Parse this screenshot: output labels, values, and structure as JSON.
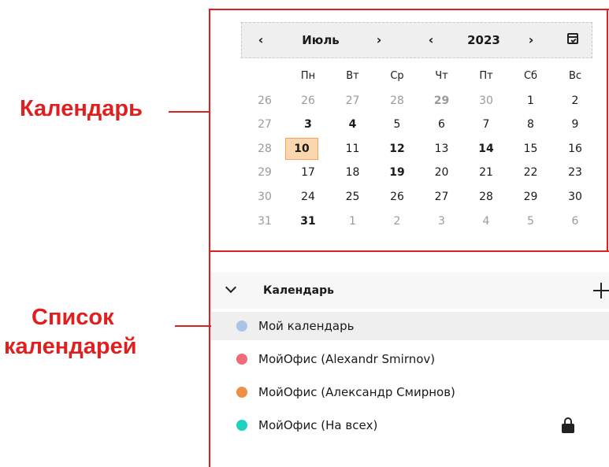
{
  "annotations": {
    "calendar_label": "Календарь",
    "list_label_line1": "Список",
    "list_label_line2": "календарей",
    "color": "#e02020"
  },
  "calendar": {
    "month": "Июль",
    "year": "2023",
    "prev_month_icon": "chevron-left-icon",
    "next_month_icon": "chevron-right-icon",
    "today_icon": "calendar-check-icon",
    "day_names": [
      "Пн",
      "Вт",
      "Ср",
      "Чт",
      "Пт",
      "Сб",
      "Вс"
    ],
    "weeks": [
      {
        "num": "26",
        "days": [
          {
            "d": "26",
            "muted": true
          },
          {
            "d": "27",
            "muted": true
          },
          {
            "d": "28",
            "muted": true
          },
          {
            "d": "29",
            "muted": true,
            "bold": true
          },
          {
            "d": "30",
            "muted": true
          },
          {
            "d": "1"
          },
          {
            "d": "2"
          }
        ]
      },
      {
        "num": "27",
        "days": [
          {
            "d": "3",
            "bold": true
          },
          {
            "d": "4",
            "bold": true
          },
          {
            "d": "5"
          },
          {
            "d": "6"
          },
          {
            "d": "7"
          },
          {
            "d": "8"
          },
          {
            "d": "9"
          }
        ]
      },
      {
        "num": "28",
        "days": [
          {
            "d": "10",
            "today": true
          },
          {
            "d": "11"
          },
          {
            "d": "12",
            "bold": true
          },
          {
            "d": "13"
          },
          {
            "d": "14",
            "bold": true
          },
          {
            "d": "15"
          },
          {
            "d": "16"
          }
        ]
      },
      {
        "num": "29",
        "days": [
          {
            "d": "17"
          },
          {
            "d": "18"
          },
          {
            "d": "19",
            "bold": true
          },
          {
            "d": "20"
          },
          {
            "d": "21"
          },
          {
            "d": "22"
          },
          {
            "d": "23"
          }
        ]
      },
      {
        "num": "30",
        "days": [
          {
            "d": "24"
          },
          {
            "d": "25"
          },
          {
            "d": "26"
          },
          {
            "d": "27"
          },
          {
            "d": "28"
          },
          {
            "d": "29"
          },
          {
            "d": "30"
          }
        ]
      },
      {
        "num": "31",
        "days": [
          {
            "d": "31",
            "bold": true
          },
          {
            "d": "1",
            "muted": true
          },
          {
            "d": "2",
            "muted": true
          },
          {
            "d": "3",
            "muted": true
          },
          {
            "d": "4",
            "muted": true
          },
          {
            "d": "5",
            "muted": true
          },
          {
            "d": "6",
            "muted": true
          }
        ]
      }
    ],
    "today_color": "#fbd7b0"
  },
  "calendar_list": {
    "title": "Календарь",
    "expand_icon": "chevron-down-icon",
    "add_icon": "plus-icon",
    "items": [
      {
        "label": "Мой календарь",
        "color": "#a9c4e6",
        "selected": true,
        "locked": false
      },
      {
        "label": "МойОфис (Alexandr Smirnov)",
        "color": "#f06a7a",
        "selected": false,
        "locked": false
      },
      {
        "label": "МойОфис (Александр Смирнов)",
        "color": "#ef8f45",
        "selected": false,
        "locked": false
      },
      {
        "label": "МойОфис (На всех)",
        "color": "#1fd1c1",
        "selected": false,
        "locked": true,
        "lock_icon": "lock-icon"
      }
    ]
  }
}
